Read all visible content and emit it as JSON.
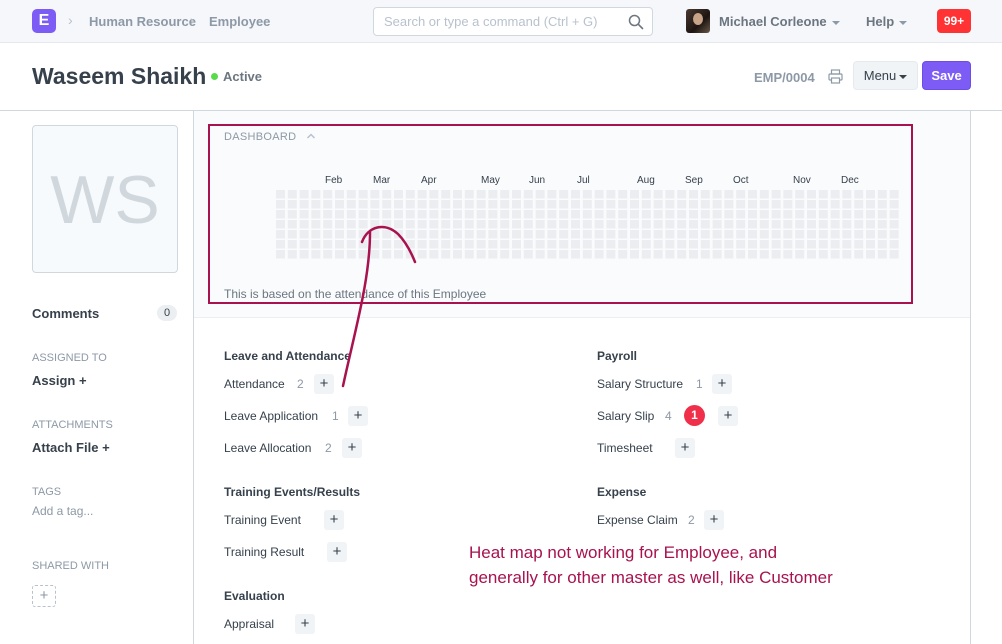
{
  "navbar": {
    "logo_letter": "E",
    "breadcrumbs": [
      "Human Resource",
      "Employee"
    ],
    "search_placeholder": "Search or type a command (Ctrl + G)",
    "user_name": "Michael Corleone",
    "help_label": "Help",
    "notification_count": "99+"
  },
  "page_head": {
    "title": "Waseem Shaikh",
    "status": "Active",
    "doc_id": "EMP/0004",
    "menu_label": "Menu",
    "save_label": "Save"
  },
  "sidebar": {
    "avatar_initials": "WS",
    "comments_label": "Comments",
    "comments_count": "0",
    "assigned_to_label": "ASSIGNED TO",
    "assign_label": "Assign +",
    "attachments_label": "ATTACHMENTS",
    "attach_label": "Attach File +",
    "tags_label": "TAGS",
    "add_tag_label": "Add a tag...",
    "shared_with_label": "SHARED WITH",
    "share_add": "+"
  },
  "dashboard": {
    "title": "DASHBOARD",
    "months": [
      "Feb",
      "Mar",
      "Apr",
      "May",
      "Jun",
      "Jul",
      "Aug",
      "Sep",
      "Oct",
      "Nov",
      "Dec"
    ],
    "note": "This is based on the attendance of this Employee",
    "heatmap": {
      "weeks": 53,
      "days": 7,
      "filled_cells": 0,
      "empty_color": "#ebedf0"
    }
  },
  "groups": {
    "leave": {
      "title": "Leave and Attendance",
      "items": [
        {
          "label": "Attendance",
          "count": "2"
        },
        {
          "label": "Leave Application",
          "count": "1"
        },
        {
          "label": "Leave Allocation",
          "count": "2"
        }
      ]
    },
    "payroll": {
      "title": "Payroll",
      "items": [
        {
          "label": "Salary Structure",
          "count": "1"
        },
        {
          "label": "Salary Slip",
          "count": "4",
          "badge": "1"
        },
        {
          "label": "Timesheet",
          "count": ""
        }
      ]
    },
    "training": {
      "title": "Training Events/Results",
      "items": [
        {
          "label": "Training Event",
          "count": ""
        },
        {
          "label": "Training Result",
          "count": ""
        }
      ]
    },
    "expense": {
      "title": "Expense",
      "items": [
        {
          "label": "Expense Claim",
          "count": "2"
        }
      ]
    },
    "evaluation": {
      "title": "Evaluation",
      "items": [
        {
          "label": "Appraisal",
          "count": ""
        }
      ]
    },
    "add_symbol": "+"
  },
  "annotation": {
    "text": "Heat map not working for Employee, and generally for other master as well, like Customer",
    "color": "#a8124f"
  },
  "colors": {
    "brand": "#7c5cf5",
    "status_active": "#5bd94d",
    "notification": "#ff3333"
  }
}
